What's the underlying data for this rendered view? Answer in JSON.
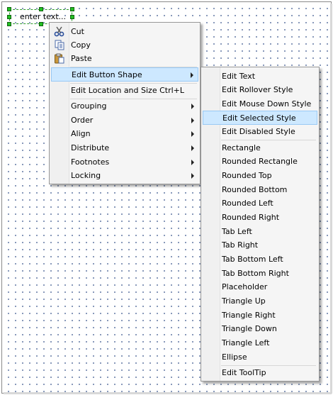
{
  "canvas": {
    "button_text": "enter text..."
  },
  "context_menu": {
    "cut": "Cut",
    "copy": "Copy",
    "paste": "Paste",
    "edit_button_shape": "Edit Button Shape",
    "edit_location": "Edit Location and Size",
    "edit_location_shortcut": "Ctrl+L",
    "grouping": "Grouping",
    "order": "Order",
    "align": "Align",
    "distribute": "Distribute",
    "footnotes": "Footnotes",
    "locking": "Locking"
  },
  "submenu": {
    "edit_items": [
      "Edit Text",
      "Edit Rollover Style",
      "Edit Mouse Down Style",
      "Edit Selected Style",
      "Edit Disabled Style"
    ],
    "shape_items": [
      "Rectangle",
      "Rounded Rectangle",
      "Rounded Top",
      "Rounded Bottom",
      "Rounded Left",
      "Rounded Right",
      "Tab Left",
      "Tab Right",
      "Tab Bottom Left",
      "Tab Bottom Right",
      "Placeholder",
      "Triangle Up",
      "Triangle Right",
      "Triangle Down",
      "Triangle Left",
      "Ellipse"
    ],
    "tooltip_item": "Edit ToolTip",
    "highlighted": "Edit Selected Style"
  },
  "colors": {
    "highlight": "#cde8ff",
    "highlight_border": "#99c9f5",
    "selection_handle": "#22c022",
    "grid_dot": "#6a7fa8"
  }
}
